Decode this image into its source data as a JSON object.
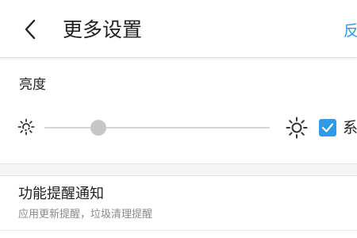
{
  "header": {
    "back_icon": "chevron-left-icon",
    "title": "更多设置",
    "feedback_label": "反"
  },
  "brightness": {
    "label": "亮度",
    "min_icon": "sun-small-icon",
    "max_icon": "sun-large-icon",
    "level_percent": 24,
    "auto_checked": true,
    "auto_label": "系"
  },
  "notification": {
    "title": "功能提醒通知",
    "subtitle": "应用更新提醒，垃圾清理提醒"
  },
  "colors": {
    "accent": "#2e9be8",
    "slider_thumb": "#c6c6c6",
    "slider_track": "#d3d3d3"
  }
}
